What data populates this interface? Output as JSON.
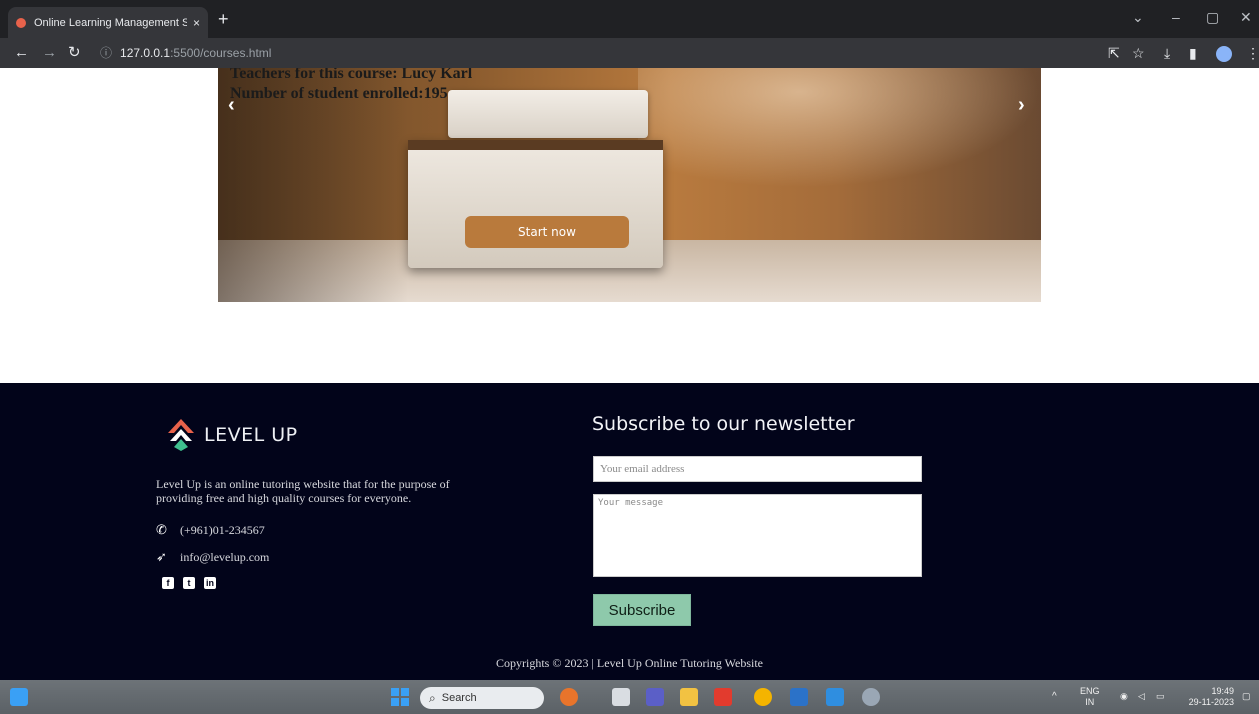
{
  "browser": {
    "tab_title": "Online Learning Management S",
    "tab_close": "×",
    "new_tab": "+",
    "url_host": "127.0.0.1",
    "url_rest": ":5500/courses.html",
    "window_controls": [
      "⌄",
      "–",
      "▢",
      "✕"
    ]
  },
  "carousel": {
    "teachers_line": "Teachers for this course: Lucy Karl",
    "enrolled_line": "Number of student enrolled:195",
    "prev_arrow": "‹",
    "next_arrow": "›",
    "start_button": "Start now"
  },
  "footer": {
    "logo_text": "LEVEL UP",
    "about": "Level Up is an online tutoring website that for the purpose of providing free and high quality courses for everyone.",
    "phone": "(+961)01-234567",
    "email": "info@levelup.com",
    "socials": [
      "facebook",
      "twitter",
      "linkedin"
    ],
    "newsletter_title": "Subscribe to our newsletter",
    "email_placeholder": "Your email address",
    "message_placeholder": "Your message",
    "subscribe_button": "Subscribe",
    "copyright": "Copyrights © 2023 | Level Up Online Tutoring Website"
  },
  "taskbar": {
    "search_label": "Search",
    "lang_top": "ENG",
    "lang_bottom": "IN",
    "time": "19:49",
    "date": "29-11-2023"
  },
  "colors": {
    "footer_bg": "#02041a",
    "start_button": "#b97a3c",
    "subscribe_button": "#8ec9ab",
    "logo_red": "#e8624b",
    "logo_green": "#3fbf8f"
  }
}
